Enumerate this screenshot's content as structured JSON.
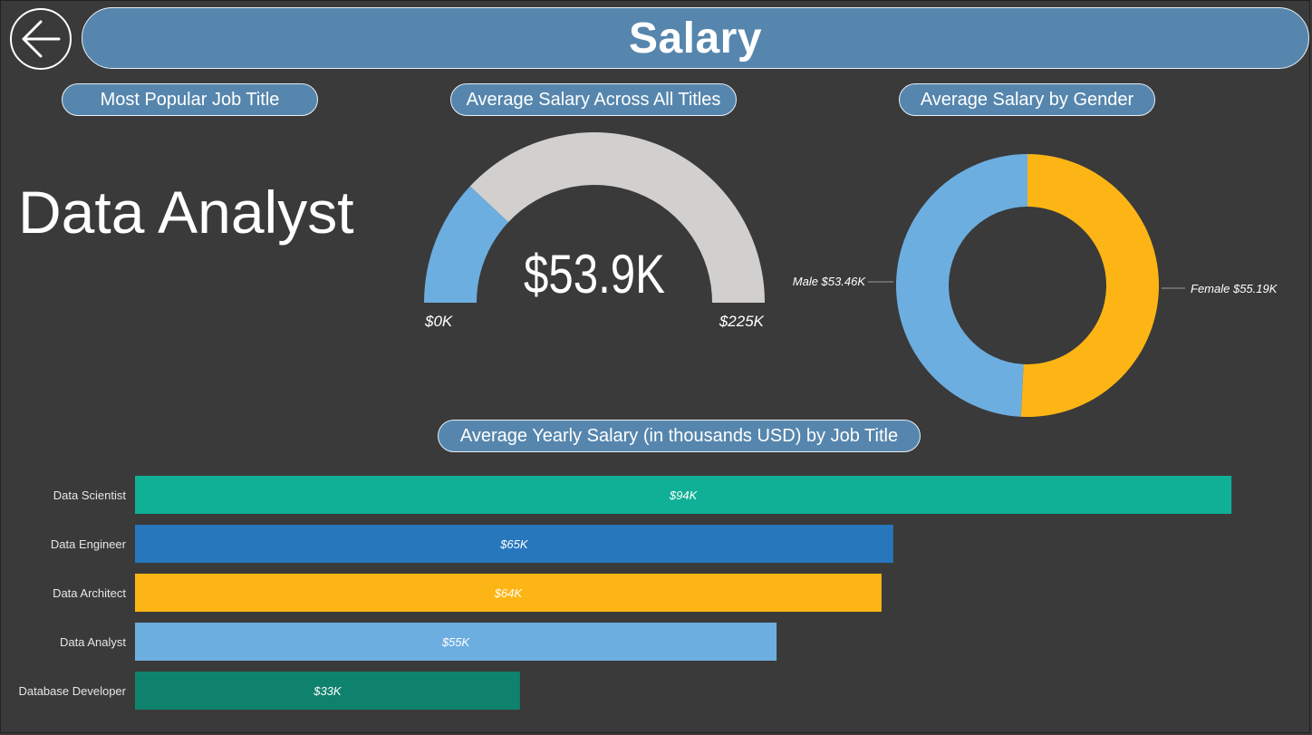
{
  "header": {
    "title": "Salary",
    "back_icon": "arrow-left-icon"
  },
  "panels": {
    "popular_title": "Most Popular Job Title",
    "popular_value": "Data Analyst",
    "avg_title": "Average Salary Across All Titles",
    "gender_title": "Average Salary by Gender",
    "bars_title": "Average Yearly Salary (in thousands USD) by Job Title"
  },
  "colors": {
    "background": "#3a3a3a",
    "pill": "#5686ad",
    "gauge_fill": "#6daee0",
    "gauge_track": "#d2d0ce",
    "male": "#6daee0",
    "female": "#fdb515"
  },
  "chart_data": [
    {
      "type": "gauge",
      "value": 53.9,
      "min": 0,
      "max": 225,
      "value_label": "$53.9K",
      "min_label": "$0K",
      "max_label": "$225K"
    },
    {
      "type": "pie",
      "donut": true,
      "slices": [
        {
          "label": "Female",
          "value": 55.19,
          "data_label": "Female $55.19K",
          "color": "#fdb515"
        },
        {
          "label": "Male",
          "value": 53.46,
          "data_label": "Male $53.46K",
          "color": "#6daee0"
        }
      ]
    },
    {
      "type": "bar",
      "orientation": "horizontal",
      "categories": [
        "Data Scientist",
        "Data Engineer",
        "Data Architect",
        "Data Analyst",
        "Database Developer"
      ],
      "values": [
        94,
        65,
        64,
        55,
        33
      ],
      "data_labels": [
        "$94K",
        "$65K",
        "$64K",
        "$55K",
        "$33K"
      ],
      "colors": [
        "#0fb095",
        "#2777bd",
        "#fdb515",
        "#6daee0",
        "#0f826e"
      ],
      "xlim": [
        0,
        95
      ]
    }
  ]
}
